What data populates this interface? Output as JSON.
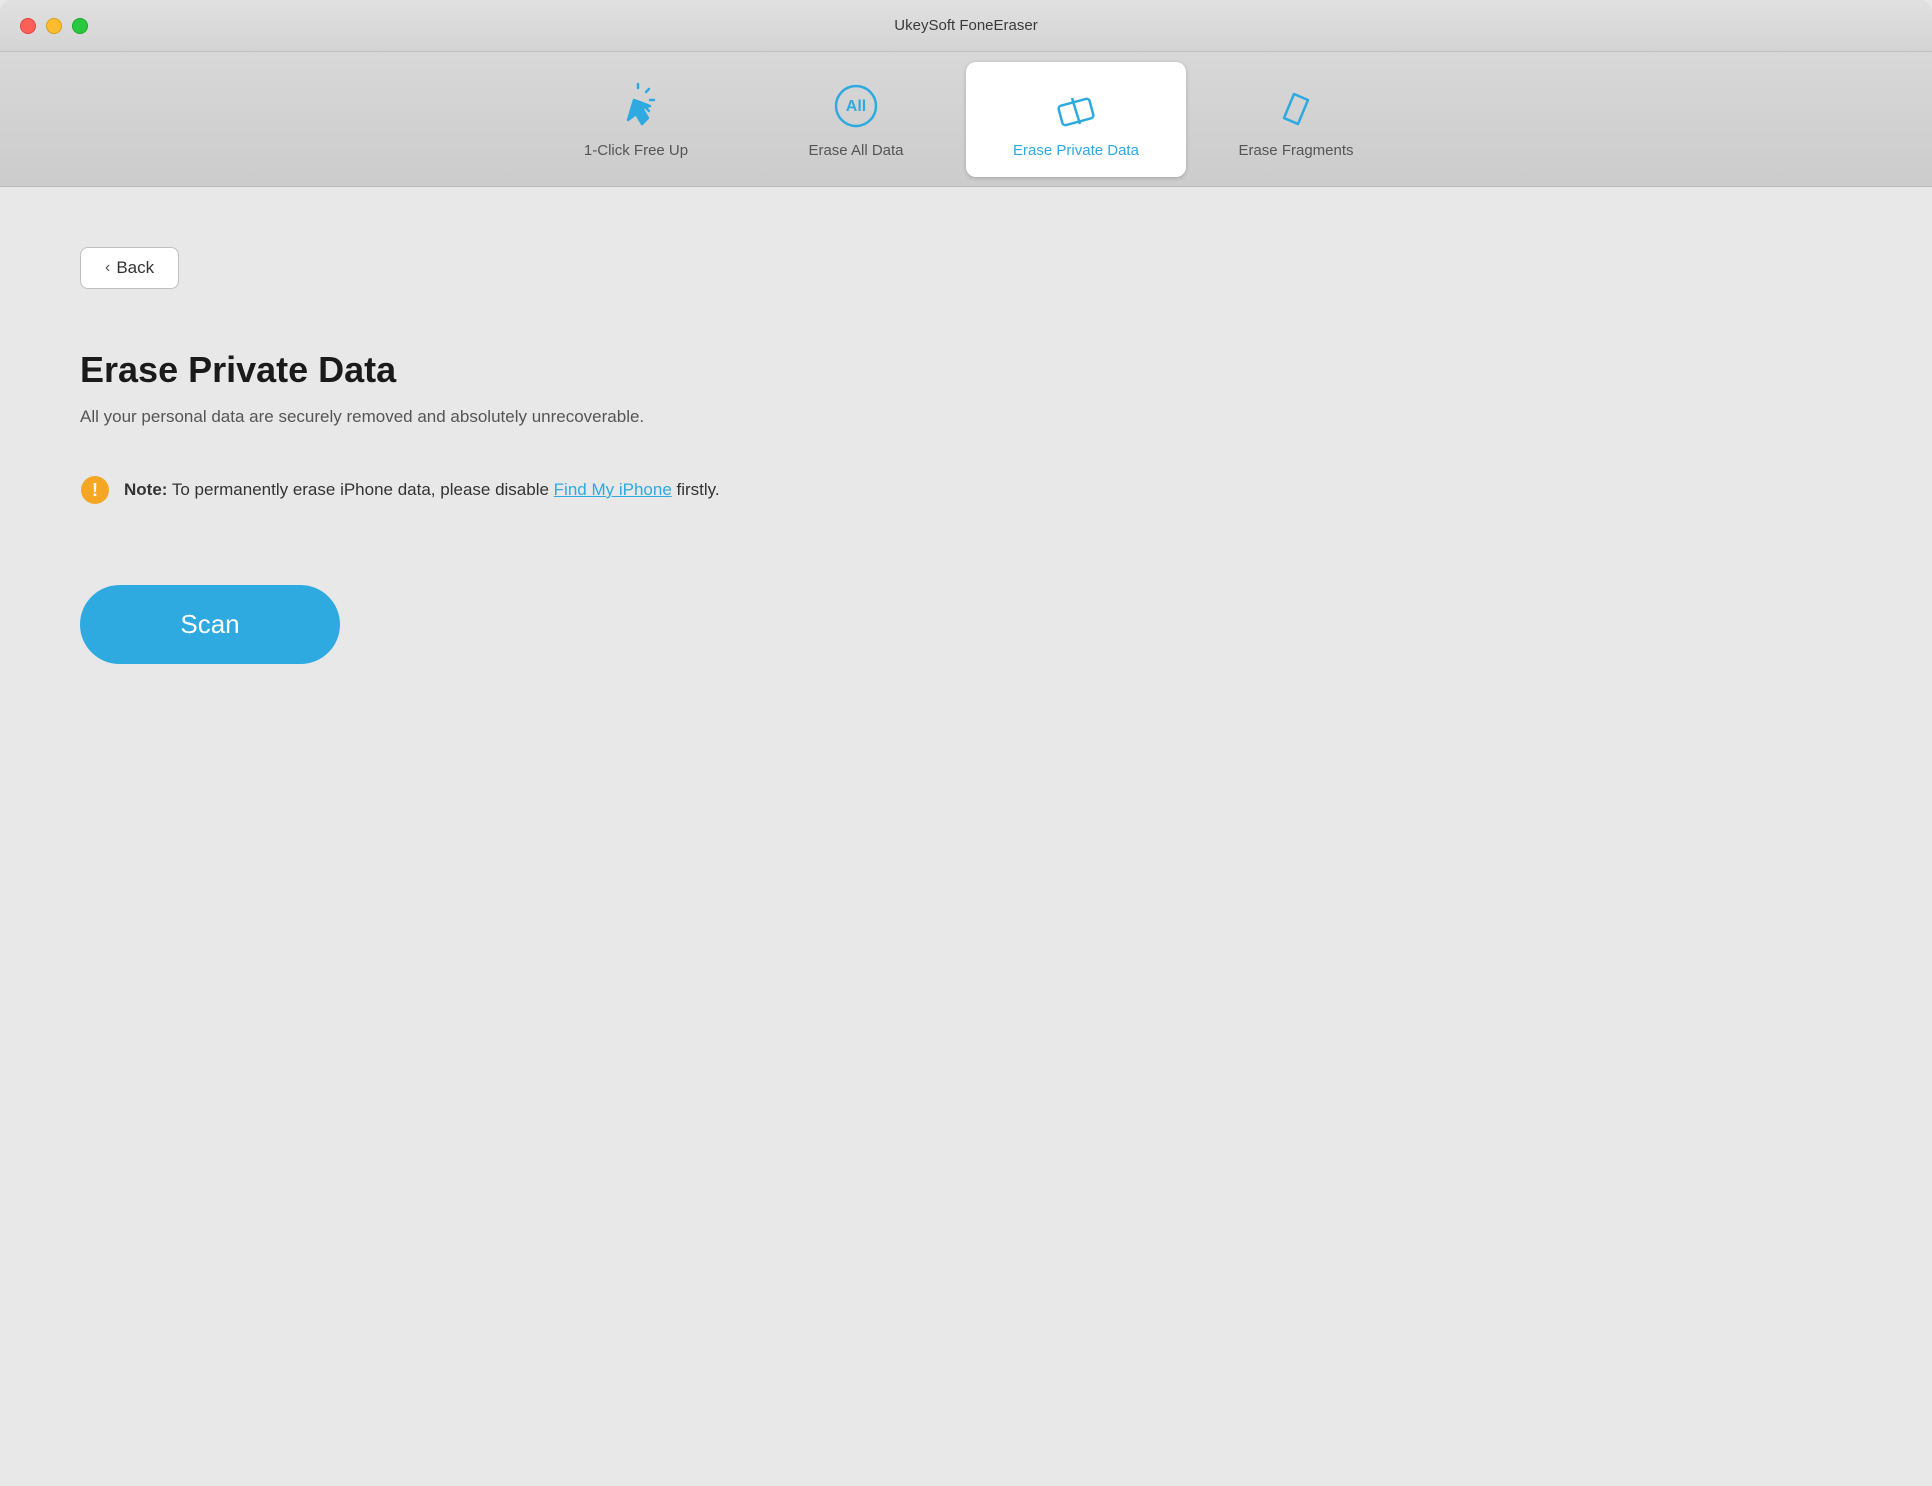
{
  "window": {
    "title": "UkeySoft FoneEraser"
  },
  "controls": {
    "close": "close",
    "minimize": "minimize",
    "maximize": "maximize"
  },
  "nav": {
    "tabs": [
      {
        "id": "one-click",
        "label": "1-Click Free Up",
        "active": false
      },
      {
        "id": "erase-all",
        "label": "Erase All Data",
        "active": false
      },
      {
        "id": "erase-private",
        "label": "Erase Private Data",
        "active": true
      },
      {
        "id": "erase-fragments",
        "label": "Erase Fragments",
        "active": false
      }
    ]
  },
  "content": {
    "back_label": "Back",
    "title": "Erase Private Data",
    "subtitle": "All your personal data are securely removed and absolutely unrecoverable.",
    "note_prefix": "Note:",
    "note_text": " To permanently erase iPhone data, please disable ",
    "note_link": "Find My iPhone",
    "note_suffix": " firstly.",
    "scan_label": "Scan"
  }
}
